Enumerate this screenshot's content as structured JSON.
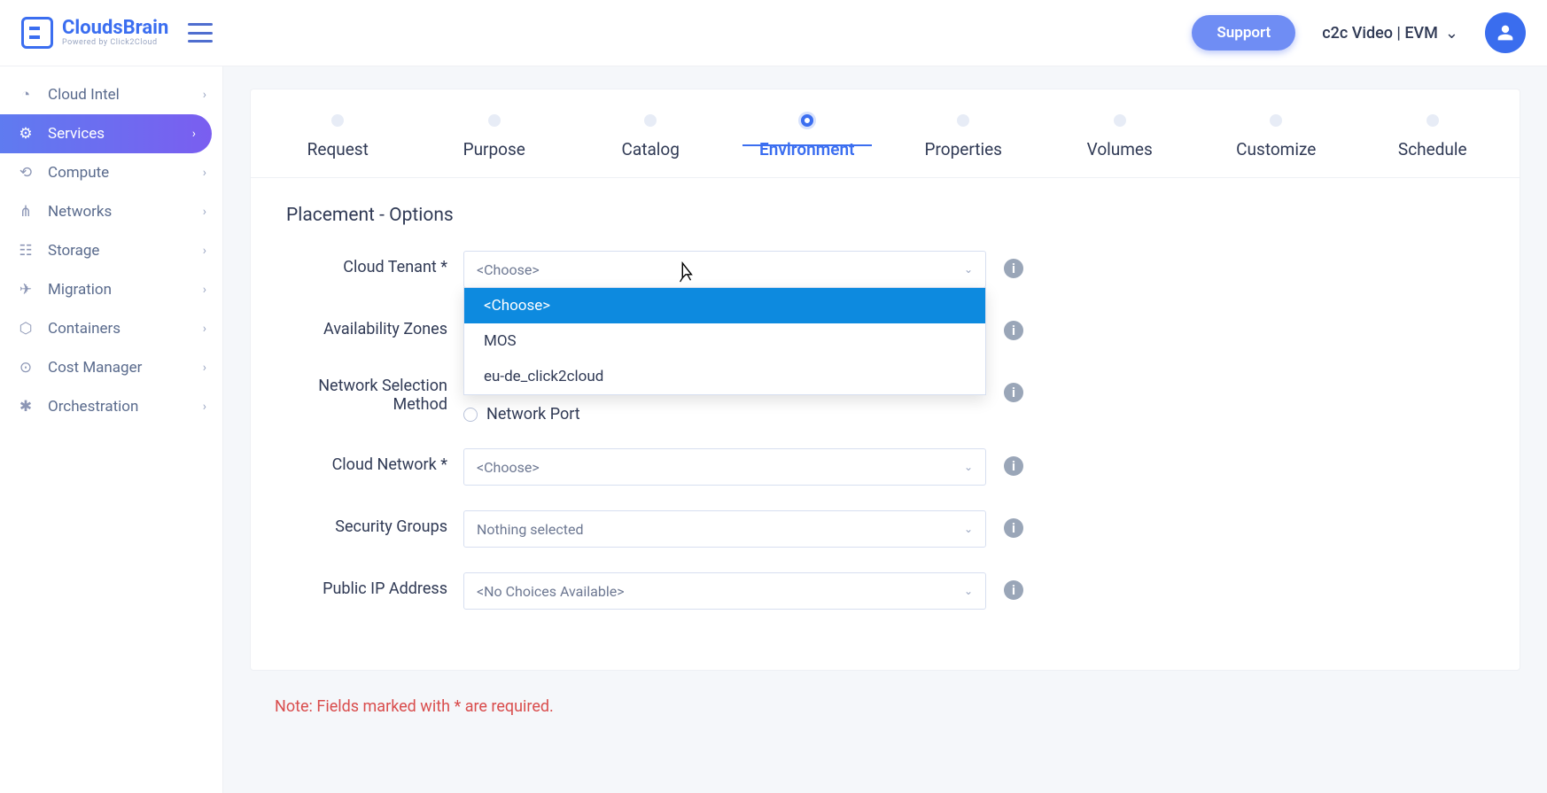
{
  "header": {
    "logo_text": "CloudsBrain",
    "logo_sub": "Powered by Click2Cloud",
    "support": "Support",
    "user_label": "c2c Video | EVM"
  },
  "sidebar": {
    "items": [
      {
        "label": "Cloud Intel"
      },
      {
        "label": "Services"
      },
      {
        "label": "Compute"
      },
      {
        "label": "Networks"
      },
      {
        "label": "Storage"
      },
      {
        "label": "Migration"
      },
      {
        "label": "Containers"
      },
      {
        "label": "Cost Manager"
      },
      {
        "label": "Orchestration"
      }
    ]
  },
  "steps": [
    "Request",
    "Purpose",
    "Catalog",
    "Environment",
    "Properties",
    "Volumes",
    "Customize",
    "Schedule"
  ],
  "form": {
    "section_title": "Placement - Options",
    "cloud_tenant_label": "Cloud Tenant *",
    "availability_zones_label": "Availability Zones",
    "network_selection_label": "Network Selection Method",
    "cloud_network_label": "Cloud Network *",
    "security_groups_label": "Security Groups",
    "public_ip_label": "Public IP Address",
    "choose_placeholder": "<Choose>",
    "nothing_selected": "Nothing selected",
    "no_choices": "<No Choices Available>",
    "tenant_options": [
      "<Choose>",
      "MOS",
      "eu-de_click2cloud"
    ],
    "radio_network_port": "Network Port"
  },
  "note": "Note: Fields marked with * are required."
}
